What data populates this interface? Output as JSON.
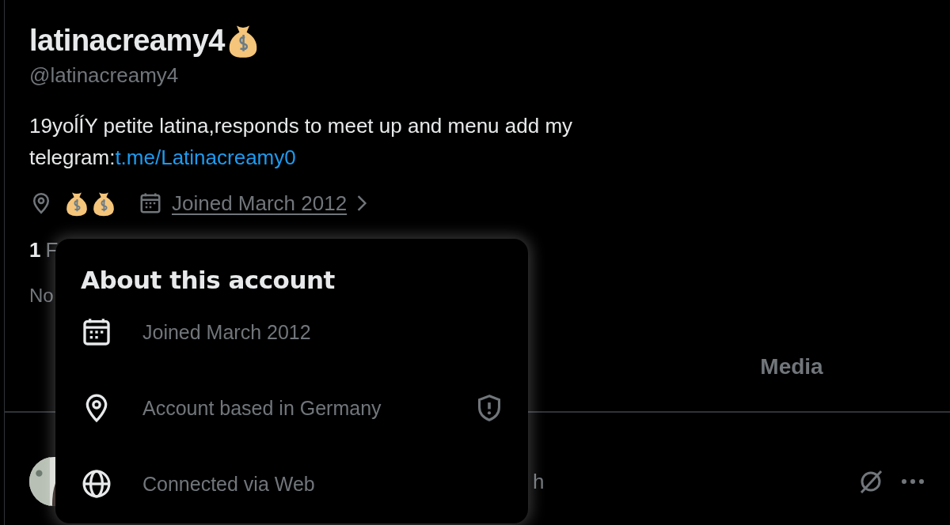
{
  "profile": {
    "display_name": "latinacreamy4",
    "handle": "@latinacreamy4",
    "bio_line_1": "19yoĺÍY petite latina,responds to meet up and menu add my",
    "bio_line_2": "telegram:",
    "bio_link": "t.me/Latinacreamy0",
    "joined": "Joined March 2012",
    "following_count": "1",
    "following_label": "F",
    "note_fragment": "No"
  },
  "tabs": [
    {
      "label": "Media",
      "selected": false
    }
  ],
  "post": {
    "time": "h"
  },
  "about_popup": {
    "title": "About this account",
    "items": [
      {
        "kind": "joined",
        "text": "Joined March 2012",
        "warning": false
      },
      {
        "kind": "location",
        "text": "Account based in Germany",
        "warning": true
      },
      {
        "kind": "connection",
        "text": "Connected via Web",
        "warning": false
      }
    ]
  }
}
